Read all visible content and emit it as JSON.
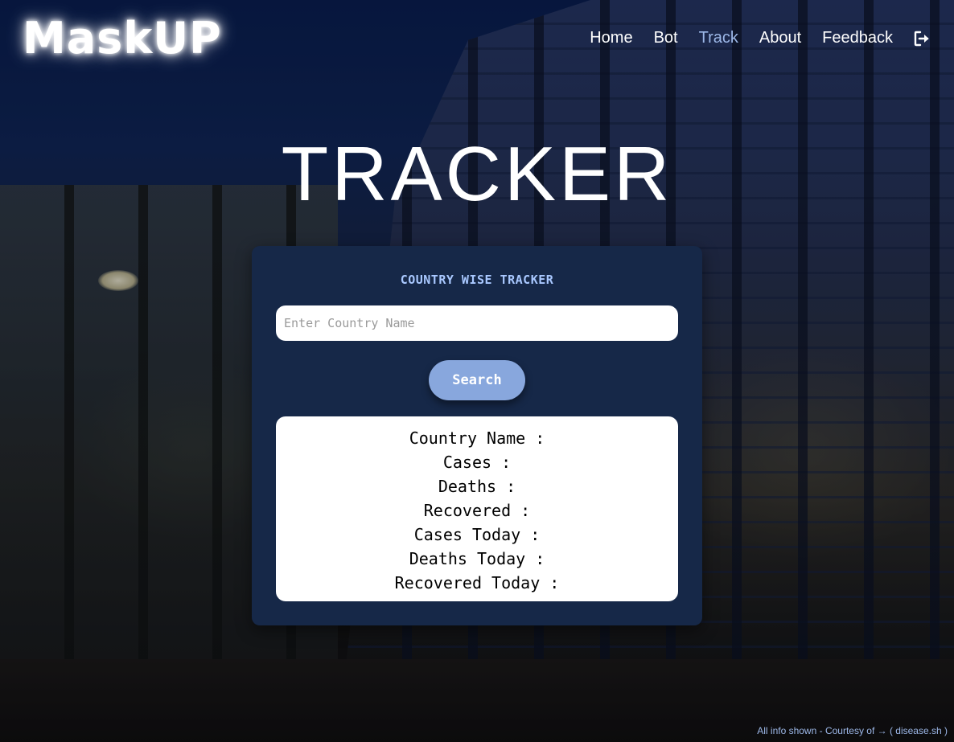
{
  "brand": {
    "logo": "MaskUP"
  },
  "nav": {
    "items": [
      {
        "label": "Home",
        "active": false
      },
      {
        "label": "Bot",
        "active": false
      },
      {
        "label": "Track",
        "active": true
      },
      {
        "label": "About",
        "active": false
      },
      {
        "label": "Feedback",
        "active": false
      }
    ],
    "logout_icon": "sign-out-icon",
    "active_color": "#9db8e8"
  },
  "page": {
    "title": "TRACKER"
  },
  "tracker": {
    "heading": "COUNTRY WISE TRACKER",
    "search_placeholder": "Enter Country Name",
    "search_value": "",
    "search_button": "Search",
    "results": [
      {
        "label": "Country Name :"
      },
      {
        "label": "Cases :"
      },
      {
        "label": "Deaths :"
      },
      {
        "label": "Recovered :"
      },
      {
        "label": "Cases Today :"
      },
      {
        "label": "Deaths Today :"
      },
      {
        "label": "Recovered Today :"
      }
    ],
    "card_color": "#162848",
    "button_color": "#88a7dd"
  },
  "footer": {
    "credit": "All info shown - Courtesy of → ( disease.sh )"
  }
}
